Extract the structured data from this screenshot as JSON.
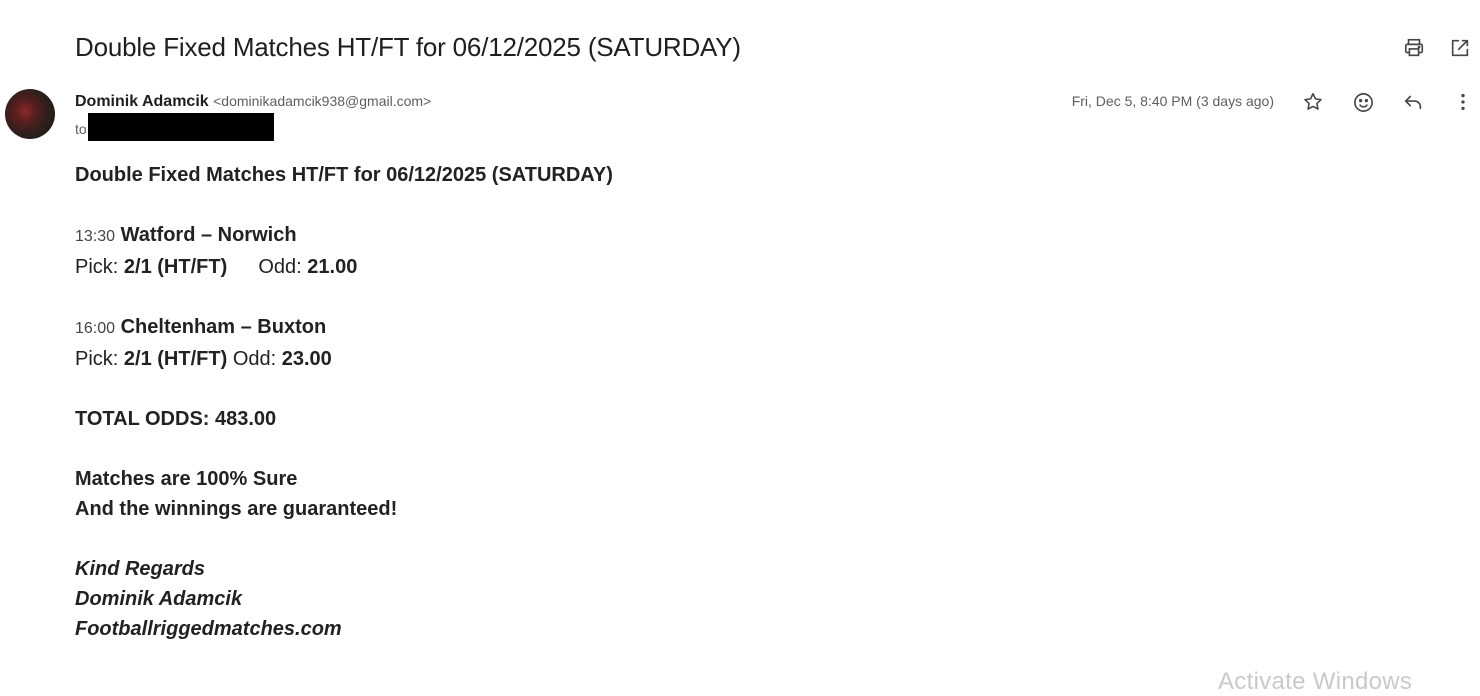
{
  "email": {
    "subject": "Double Fixed Matches HT/FT for 06/12/2025 (SATURDAY)",
    "sender_name": "Dominik Adamcik",
    "sender_email": "<dominikadamcik938@gmail.com>",
    "to_label": "to",
    "date": "Fri, Dec 5, 8:40 PM (3 days ago)"
  },
  "icons": {
    "print": "print-icon",
    "open_new_window": "open-in-new-window-icon",
    "star": "star-icon",
    "emoji": "emoji-icon",
    "reply": "reply-icon",
    "more": "more-vert-icon"
  },
  "body": {
    "heading": "Double Fixed Matches HT/FT for 06/12/2025 (SATURDAY)",
    "matches": [
      {
        "time": "13:30",
        "teams": "Watford – Norwich",
        "pick_label": "Pick:",
        "pick": "2/1 (HT/FT)",
        "odd_label": "Odd:",
        "odd": "21.00"
      },
      {
        "time": "16:00",
        "teams": "Cheltenham – Buxton",
        "pick_label": "Pick:",
        "pick": "2/1 (HT/FT)",
        "odd_label": "Odd:",
        "odd": "23.00"
      }
    ],
    "total_odds": "TOTAL ODDS: 483.00",
    "line_sure": "Matches are 100% Sure",
    "line_guarantee": "And the winnings are guaranteed!",
    "sign_regards": "Kind Regards",
    "sign_name": "Dominik Adamcik",
    "sign_site": "Footballriggedmatches.com"
  },
  "overlay": {
    "watermark": "Activate Windows"
  },
  "colors": {
    "text": "#1f1f1f",
    "muted": "#5e5e5e",
    "icon": "#444746"
  }
}
